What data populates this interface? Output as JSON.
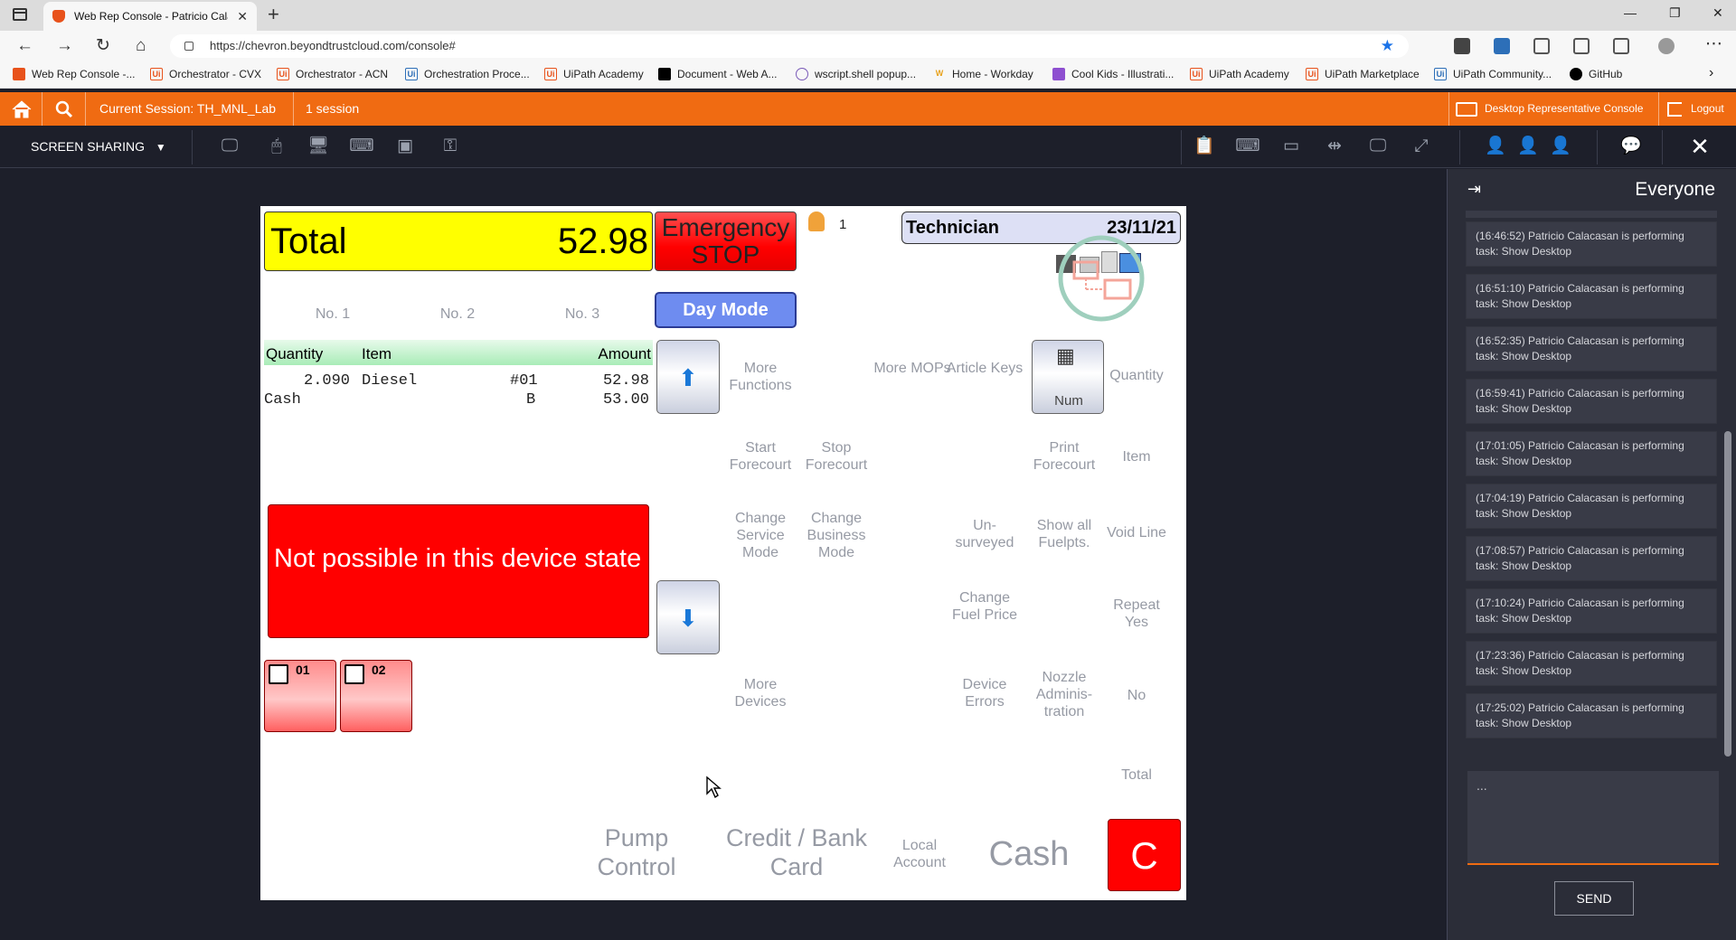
{
  "browser": {
    "tab_title": "Web Rep Console - Patricio Calacasan",
    "url": "https://chevron.beyondtrustcloud.com/console#",
    "bookmarks": [
      {
        "label": "Web Rep Console -..."
      },
      {
        "label": "Orchestrator - CVX"
      },
      {
        "label": "Orchestrator - ACN"
      },
      {
        "label": "Orchestration Proce..."
      },
      {
        "label": "UiPath Academy"
      },
      {
        "label": "Document - Web A..."
      },
      {
        "label": "wscript.shell popup..."
      },
      {
        "label": "Home - Workday"
      },
      {
        "label": "Cool Kids - Illustrati..."
      },
      {
        "label": "UiPath Academy"
      },
      {
        "label": "UiPath Marketplace"
      },
      {
        "label": "UiPath Community..."
      },
      {
        "label": "GitHub"
      }
    ]
  },
  "session_bar": {
    "current_session": "Current Session: TH_MNL_Lab",
    "sessions": "1 session",
    "desktop_console": "Desktop Representative Console",
    "logout": "Logout"
  },
  "toolbar": {
    "screen_sharing": "SCREEN SHARING"
  },
  "pos": {
    "total_label": "Total",
    "total_value": "52.98",
    "emergency": "Emergency STOP",
    "operator_count": "1",
    "technician": "Technician",
    "date": "23/11/21",
    "day_mode": "Day Mode",
    "tabs": [
      "No. 1",
      "No. 2",
      "No. 3"
    ],
    "receipt_header": {
      "quantity": "Quantity",
      "item": "Item",
      "amount": "Amount"
    },
    "receipt_line1": {
      "qty": "2.090",
      "name": "Diesel",
      "code": "#01",
      "amount": "52.98"
    },
    "receipt_line2": {
      "name": "Cash",
      "code": "B",
      "amount": "53.00"
    },
    "error_message": "Not possible in this device state",
    "pumps": [
      "01",
      "02"
    ],
    "num_label": "Num",
    "buttons": {
      "more_functions": "More Functions",
      "more_mops": "More MOPs",
      "article_keys": "Article Keys",
      "quantity": "Quantity",
      "start_forecourt": "Start Forecourt",
      "stop_forecourt": "Stop Forecourt",
      "print_forecourt": "Print Forecourt",
      "item": "Item",
      "change_service_mode": "Change Service Mode",
      "change_business_mode": "Change Business Mode",
      "unsurveyed": "Un- surveyed",
      "show_all_fuelpts": "Show all Fuelpts.",
      "void_line": "Void Line",
      "change_fuel_price": "Change Fuel Price",
      "repeat_yes": "Repeat Yes",
      "more_devices": "More Devices",
      "device_errors": "Device Errors",
      "nozzle_admin": "Nozzle Adminis- tration",
      "no": "No",
      "total": "Total",
      "pump_control": "Pump Control",
      "credit_bank_card": "Credit / Bank Card",
      "local_account": "Local Account",
      "cash": "Cash",
      "c": "C"
    }
  },
  "chat": {
    "title": "Everyone",
    "messages": [
      "(16:46:52) Patricio Calacasan is performing task: Show Desktop",
      "(16:51:10) Patricio Calacasan is performing task: Show Desktop",
      "(16:52:35) Patricio Calacasan is performing task: Show Desktop",
      "(16:59:41) Patricio Calacasan is performing task: Show Desktop",
      "(17:01:05) Patricio Calacasan is performing task: Show Desktop",
      "(17:04:19) Patricio Calacasan is performing task: Show Desktop",
      "(17:08:57) Patricio Calacasan is performing task: Show Desktop",
      "(17:10:24) Patricio Calacasan is performing task: Show Desktop",
      "(17:23:36) Patricio Calacasan is performing task: Show Desktop",
      "(17:25:02) Patricio Calacasan is performing task: Show Desktop"
    ],
    "input_value": "...",
    "send": "SEND"
  },
  "colors": {
    "accent_orange": "#f06b12",
    "dark_bg": "#1d1f2a",
    "pos_yellow": "#ffff00",
    "pos_red": "#ff0000"
  }
}
